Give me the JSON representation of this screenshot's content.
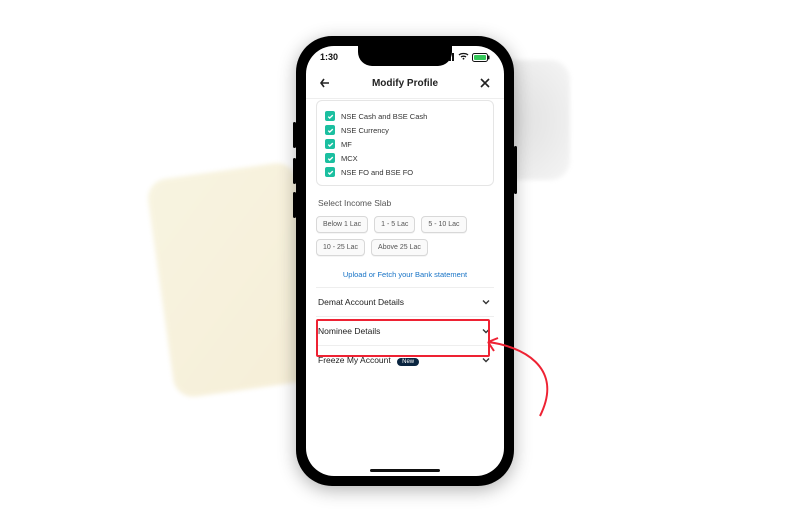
{
  "status": {
    "time": "1:30",
    "battery_text": ""
  },
  "header": {
    "title": "Modify Profile"
  },
  "segments": {
    "items": [
      {
        "label": "NSE Cash and BSE Cash"
      },
      {
        "label": "NSE Currency"
      },
      {
        "label": "MF"
      },
      {
        "label": "MCX"
      },
      {
        "label": "NSE FO and BSE FO"
      }
    ]
  },
  "income": {
    "title": "Select Income Slab",
    "slabs": [
      {
        "label": "Below 1 Lac"
      },
      {
        "label": "1 - 5 Lac"
      },
      {
        "label": "5 - 10 Lac"
      },
      {
        "label": "10 - 25 Lac"
      },
      {
        "label": "Above 25 Lac"
      }
    ]
  },
  "bank_link": {
    "label": "Upload or Fetch your Bank statement"
  },
  "accordions": [
    {
      "label": "Demat Account Details",
      "badge": ""
    },
    {
      "label": "Nominee Details",
      "badge": ""
    },
    {
      "label": "Freeze My Account",
      "badge": "New"
    }
  ]
}
